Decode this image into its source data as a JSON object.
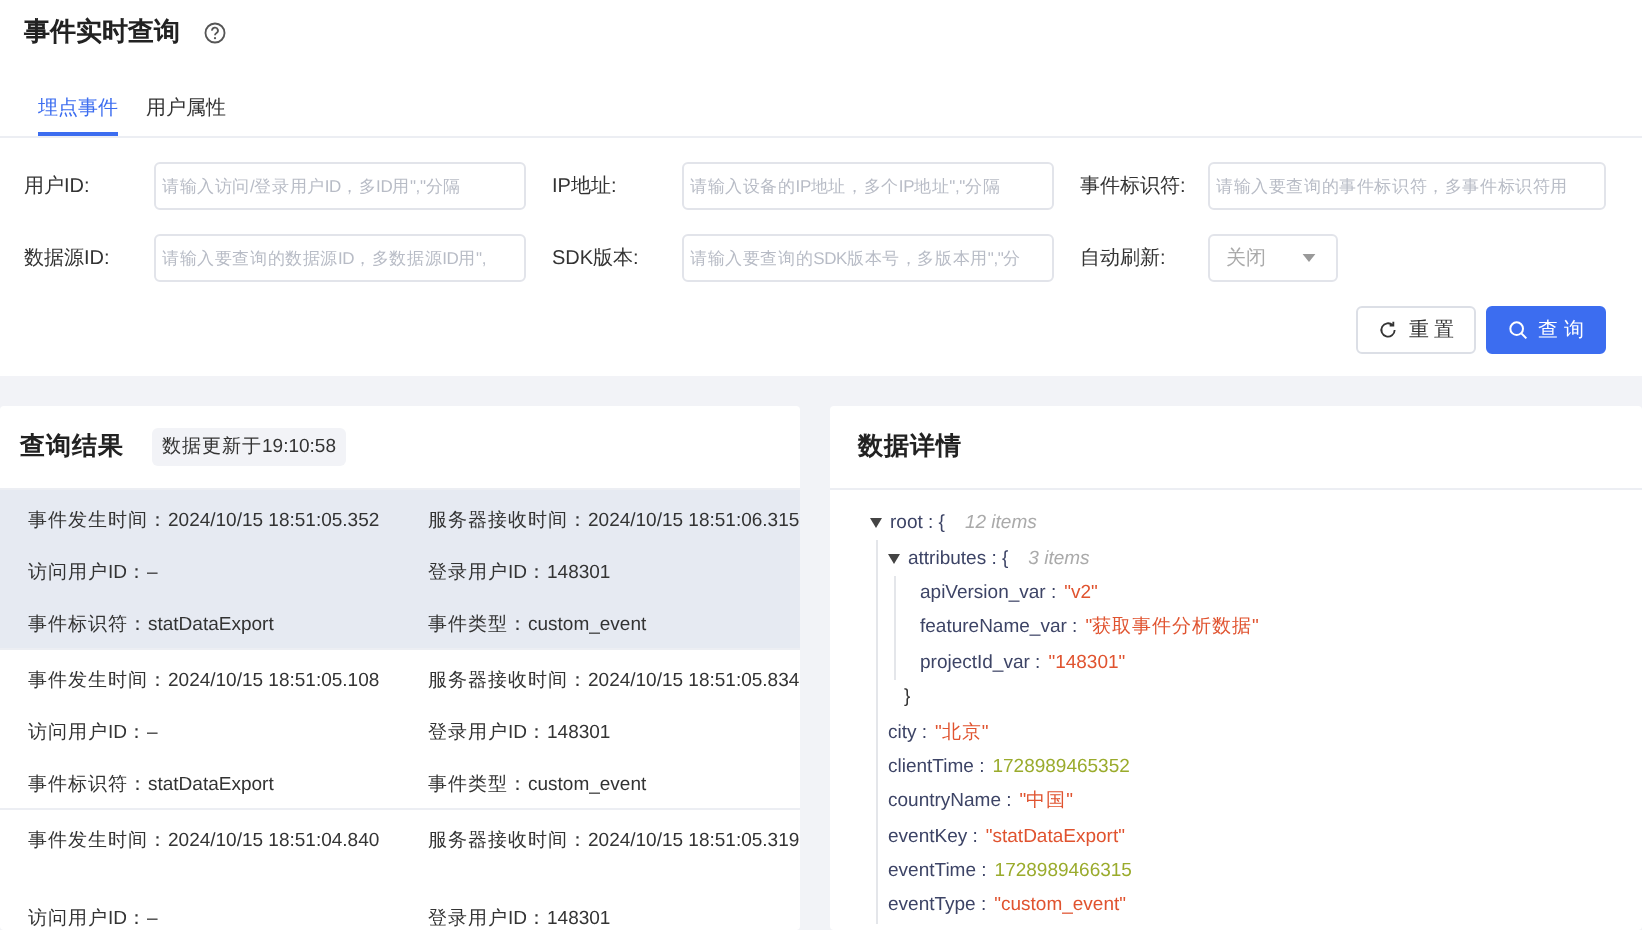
{
  "page_title": "事件实时查询",
  "tabs": [
    {
      "label": "埋点事件",
      "selected": true
    },
    {
      "label": "用户属性",
      "selected": false
    }
  ],
  "filters": [
    {
      "kind": "input",
      "label": "用户ID:",
      "placeholder": "请输入访问/登录用户ID，多ID用\",\"分隔"
    },
    {
      "kind": "input",
      "label": "IP地址:",
      "placeholder": "请输入设备的IP地址，多个IP地址\",\"分隔"
    },
    {
      "kind": "input",
      "label": "事件标识符:",
      "placeholder": "请输入要查询的事件标识符，多事件标识符用"
    },
    {
      "kind": "input",
      "label": "数据源ID:",
      "placeholder": "请输入要查询的数据源ID，多数据源ID用\","
    },
    {
      "kind": "input",
      "label": "SDK版本:",
      "placeholder": "请输入要查询的SDK版本号，多版本用\",\"分"
    },
    {
      "kind": "select",
      "label": "自动刷新:",
      "value": "关闭"
    }
  ],
  "buttons": [
    {
      "kind": "reset",
      "label": "重 置"
    },
    {
      "kind": "query",
      "label": "查 询"
    }
  ],
  "results": {
    "title": "查询结果",
    "updated": "数据更新于19:10:58",
    "records": [
      {
        "selected": true,
        "fields": [
          "事件发生时间：2024/10/15 18:51:05.352",
          "服务器接收时间：2024/10/15 18:51:06.315",
          "访问用户ID：–",
          "登录用户ID：148301",
          "事件标识符：statDataExport",
          "事件类型：custom_event"
        ]
      },
      {
        "selected": false,
        "fields": [
          "事件发生时间：2024/10/15 18:51:05.108",
          "服务器接收时间：2024/10/15 18:51:05.834",
          "访问用户ID：–",
          "登录用户ID：148301",
          "事件标识符：statDataExport",
          "事件类型：custom_event"
        ]
      },
      {
        "selected": false,
        "fields": [
          "事件发生时间：2024/10/15 18:51:04.840",
          "服务器接收时间：2024/10/15 18:51:05.319",
          "访问用户ID：–",
          "登录用户ID：148301"
        ]
      }
    ]
  },
  "details": {
    "title": "数据详情",
    "tree": {
      "key": "root :",
      "open": "{",
      "count": "12 items",
      "expanded": true,
      "children": [
        {
          "key": "attributes :",
          "open": "{",
          "count": "3 items",
          "close": "}",
          "expanded": true,
          "children": [
            {
              "key": "apiVersion_var :",
              "kind": "string",
              "value": "\"v2\""
            },
            {
              "key": "featureName_var :",
              "kind": "string",
              "value": "\"获取事件分析数据\""
            },
            {
              "key": "projectId_var :",
              "kind": "string",
              "value": "\"148301\""
            }
          ]
        },
        {
          "key": "city :",
          "kind": "string",
          "value": "\"北京\""
        },
        {
          "key": "clientTime :",
          "kind": "number",
          "value": "1728989465352"
        },
        {
          "key": "countryName :",
          "kind": "string",
          "value": "\"中国\""
        },
        {
          "key": "eventKey :",
          "kind": "string",
          "value": "\"statDataExport\""
        },
        {
          "key": "eventTime :",
          "kind": "number",
          "value": "1728989466315"
        },
        {
          "key": "eventType :",
          "kind": "string",
          "value": "\"custom_event\""
        }
      ]
    }
  }
}
